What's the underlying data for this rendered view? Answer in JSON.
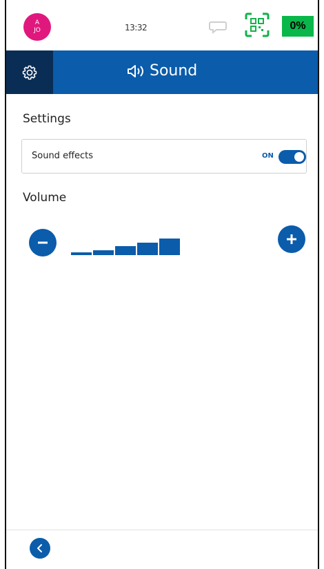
{
  "status_bar": {
    "avatar_initials_top": "A",
    "avatar_initials_bottom": "JO",
    "time": "13:32",
    "battery": "0%"
  },
  "header": {
    "title": "Sound",
    "icons": [
      "gear-icon",
      "speaker-icon"
    ]
  },
  "settings": {
    "section_label": "Settings",
    "sound_effects": {
      "label": "Sound effects",
      "state": "ON"
    }
  },
  "volume": {
    "section_label": "Volume",
    "levels_total": 5,
    "levels_on": 5
  },
  "colors": {
    "primary": "#0b5cab",
    "dark_tab": "#0a2d55",
    "avatar": "#e0187e",
    "battery": "#0ab74a"
  }
}
